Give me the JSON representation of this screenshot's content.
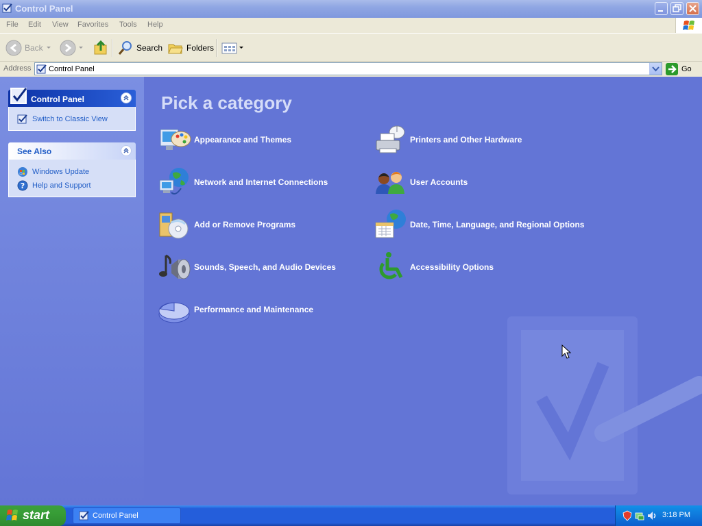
{
  "window": {
    "title": "Control Panel"
  },
  "menu": [
    "File",
    "Edit",
    "View",
    "Favorites",
    "Tools",
    "Help"
  ],
  "toolbar": {
    "back": "Back",
    "search": "Search",
    "folders": "Folders"
  },
  "address": {
    "label": "Address",
    "value": "Control Panel",
    "go": "Go"
  },
  "left_pane": {
    "control_panel": {
      "title": "Control Panel",
      "tasks": [
        "Switch to Classic View"
      ]
    },
    "see_also": {
      "title": "See Also",
      "links": [
        "Windows Update",
        "Help and Support"
      ]
    }
  },
  "main": {
    "heading": "Pick a category",
    "categories": [
      {
        "label": "Appearance and Themes",
        "icon": "appearance-icon"
      },
      {
        "label": "Printers and Other Hardware",
        "icon": "printer-icon"
      },
      {
        "label": "Network and Internet Connections",
        "icon": "network-icon"
      },
      {
        "label": "User Accounts",
        "icon": "users-icon"
      },
      {
        "label": "Add or Remove Programs",
        "icon": "programs-icon"
      },
      {
        "label": "Date, Time, Language, and Regional Options",
        "icon": "datetime-icon"
      },
      {
        "label": "Sounds, Speech, and Audio Devices",
        "icon": "sound-icon"
      },
      {
        "label": "Accessibility Options",
        "icon": "accessibility-icon"
      },
      {
        "label": "Performance and Maintenance",
        "icon": "performance-icon"
      }
    ]
  },
  "taskbar": {
    "start": "start",
    "task": "Control Panel",
    "clock": "3:18 PM"
  },
  "colors": {
    "content_bg": "#6375d6",
    "taskbar": "#245edb",
    "start": "#379d36"
  }
}
